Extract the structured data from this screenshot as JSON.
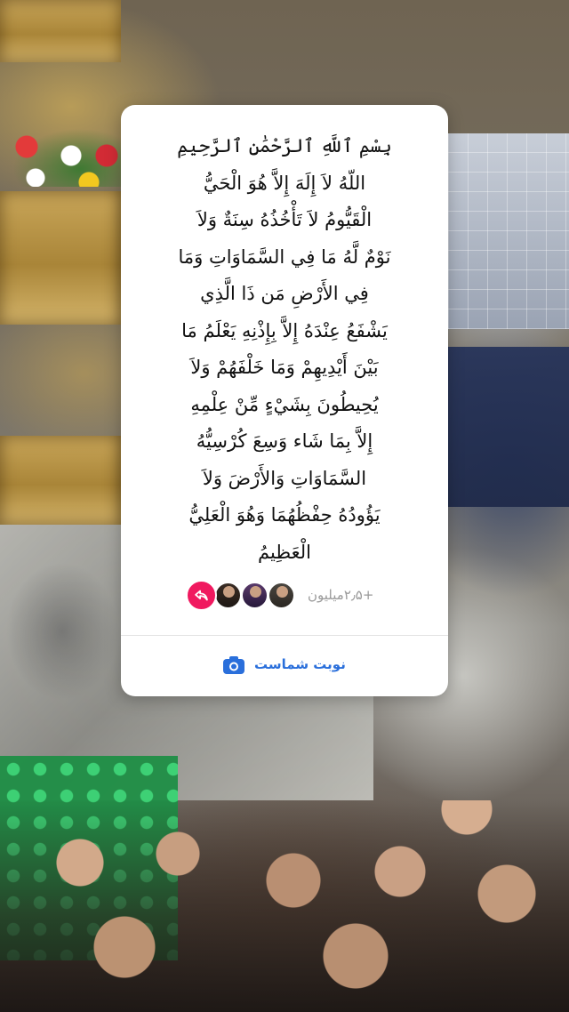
{
  "story": {
    "verse_lines": [
      "بِسْمِ ٱللَّهِ ٱلرَّحْمَٰنِ ٱلرَّحِيمِ",
      "اللّهُ لاَ إِلَهَ إِلاَّ هُوَ الْحَيُّ",
      "الْقَيُّومُ لاَ تَأْخُذُهُ سِنَةٌ وَلاَ",
      "نَوْمٌ لَّهُ مَا فِي السَّمَاوَاتِ وَمَا",
      "فِي الأَرْضِ مَن ذَا الَّذِي",
      "يَشْفَعُ عِنْدَهُ إِلاَّ بِإِذْنِهِ يَعْلَمُ مَا",
      "بَيْنَ أَيْدِيهِمْ وَمَا خَلْفَهُمْ وَلاَ",
      "يُحِيطُونَ بِشَيْءٍ مِّنْ عِلْمِهِ",
      "إِلاَّ بِمَا شَاء وَسِعَ كُرْسِيُّهُ",
      "السَّمَاوَاتِ وَالأَرْضَ وَلاَ",
      "يَؤُودُهُ حِفْظُهُمَا وَهُوَ الْعَلِيُّ",
      "الْعَظِيمُ"
    ],
    "reactions": {
      "count_text": "+۲٫۵میلیون",
      "reaction_icon": "share-arrow-icon",
      "reaction_color": "#f0195f"
    },
    "action": {
      "label": "نوبت شماست",
      "icon": "camera-icon",
      "color": "#2a6fdb"
    }
  }
}
